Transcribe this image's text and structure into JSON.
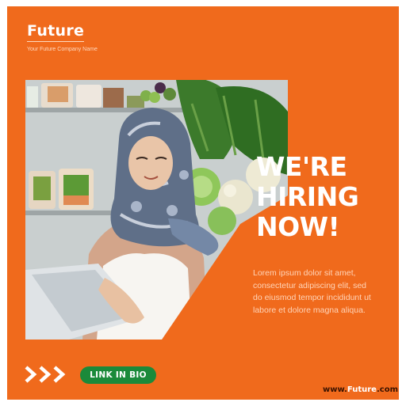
{
  "brand": {
    "name": "Future",
    "tagline": "Your Future Company Name"
  },
  "headline": {
    "line1": "WE'RE",
    "line2": "HIRING",
    "line3": "NOW!"
  },
  "body_text": "Lorem ipsum dolor sit amet, consectetur adipiscing elit, sed do eiusmod tempor incididunt ut labore et dolore magna aliqua.",
  "cta": {
    "label": "LINK IN BIO"
  },
  "website": {
    "prefix": "www.",
    "accent": "Future",
    "suffix": ".com"
  },
  "colors": {
    "background": "#f06a1c",
    "button": "#1b8a3a",
    "text": "#ffffff"
  },
  "icons": {
    "arrows": "triple-chevron-right-icon"
  }
}
